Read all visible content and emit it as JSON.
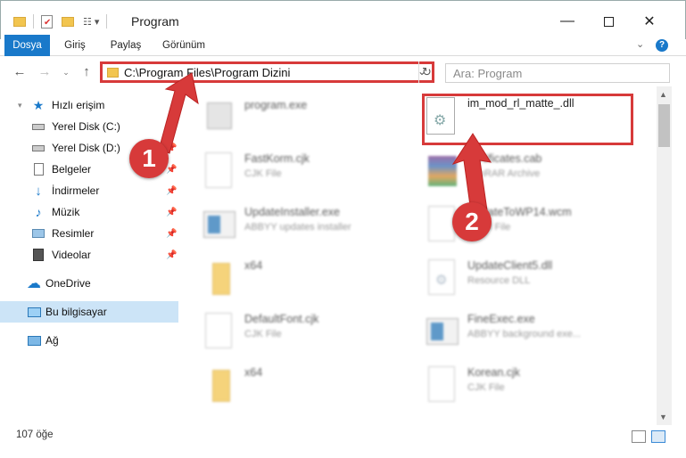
{
  "window": {
    "title": "Program"
  },
  "ribbon": {
    "tabs": [
      "Dosya",
      "Giriş",
      "Paylaş",
      "Görünüm"
    ]
  },
  "address": {
    "path": "C:\\Program Files\\Program Dizini"
  },
  "search": {
    "placeholder": "Ara: Program"
  },
  "sidebar": {
    "quick_access": "Hızlı erişim",
    "items": [
      {
        "label": "Yerel Disk (C:)",
        "icon": "drive-icon"
      },
      {
        "label": "Yerel Disk (D:)",
        "icon": "drive-icon"
      },
      {
        "label": "Belgeler",
        "icon": "documents-icon"
      },
      {
        "label": "İndirmeler",
        "icon": "download-icon"
      },
      {
        "label": "Müzik",
        "icon": "music-icon"
      },
      {
        "label": "Resimler",
        "icon": "pictures-icon"
      },
      {
        "label": "Videolar",
        "icon": "videos-icon"
      }
    ],
    "onedrive": "OneDrive",
    "this_pc": "Bu bilgisayar",
    "network": "Ağ"
  },
  "files": [
    {
      "name": "program.exe",
      "type": ""
    },
    {
      "name": "im_mod_rl_matte_.dll",
      "type": ""
    },
    {
      "name": "FastKorm.cjk",
      "type": "CJK File"
    },
    {
      "name": "certificates.cab",
      "type": "WinRAR Archive"
    },
    {
      "name": "UpdateInstaller.exe",
      "type": "ABBYY updates installer"
    },
    {
      "name": "UpdateToWP14.wcm",
      "type": "WCM File"
    },
    {
      "name": "x64",
      "type": ""
    },
    {
      "name": "UpdateClient5.dll",
      "type": "Resource DLL"
    },
    {
      "name": "DefaultFont.cjk",
      "type": "CJK File"
    },
    {
      "name": "FineExec.exe",
      "type": "ABBYY background exe..."
    },
    {
      "name": "x64",
      "type": ""
    },
    {
      "name": "Korean.cjk",
      "type": "CJK File"
    }
  ],
  "status": {
    "count": "107 öğe"
  },
  "annotations": {
    "badge1": "1",
    "badge2": "2"
  },
  "colors": {
    "accent": "#1979ca",
    "highlight": "#d73a3a",
    "selection": "#cce4f7"
  }
}
